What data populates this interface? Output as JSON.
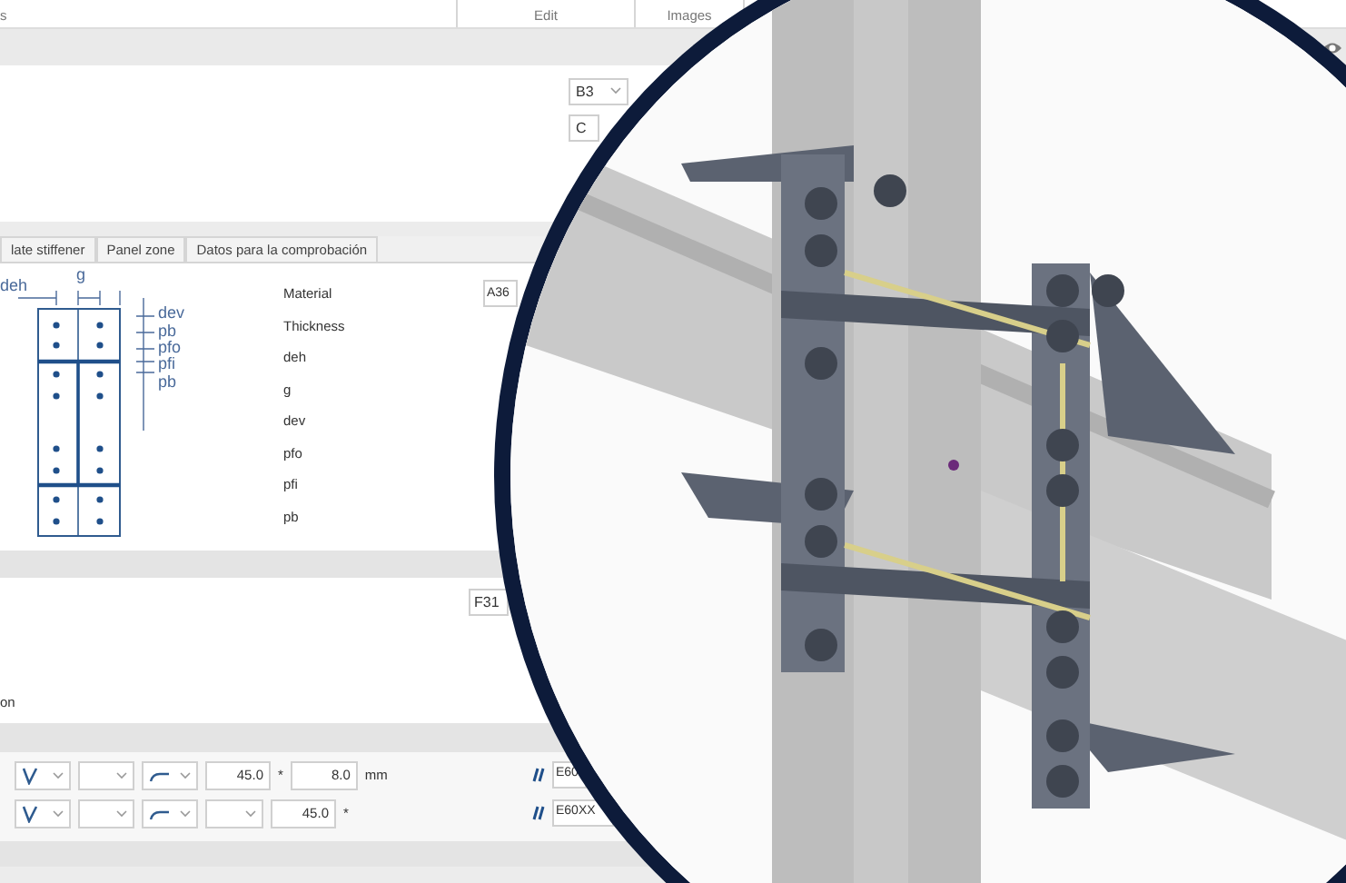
{
  "ribbon": {
    "groups": [
      {
        "label": "s"
      },
      {
        "label": "Edit"
      },
      {
        "label": "Images"
      }
    ]
  },
  "top_panel": {
    "fields": [
      {
        "kind": "select",
        "value": "B3"
      },
      {
        "kind": "text",
        "value": "C"
      }
    ]
  },
  "tabs": [
    {
      "label": "late stiffener",
      "selected": false
    },
    {
      "label": "Panel zone",
      "selected": false
    },
    {
      "label": "Datos para la comprobación",
      "selected": false
    }
  ],
  "diagram": {
    "labels": [
      "deh",
      "g",
      "dev",
      "pb",
      "pfo",
      "pfi",
      "pb"
    ]
  },
  "properties": [
    {
      "label": "Material",
      "value": "A36"
    },
    {
      "label": "Thickness"
    },
    {
      "label": "deh"
    },
    {
      "label": "g"
    },
    {
      "label": "dev"
    },
    {
      "label": "pfo"
    },
    {
      "label": "pfi"
    },
    {
      "label": "pb"
    }
  ],
  "lower_panel": {
    "field": "F31",
    "text": "on"
  },
  "weld_rows": [
    {
      "angle": "45.0",
      "angle_mark": "*",
      "size": "8.0",
      "unit": "mm",
      "electrode": "E60"
    },
    {
      "angle": "45.0",
      "angle_mark": "*",
      "electrode": "E60XX"
    }
  ]
}
